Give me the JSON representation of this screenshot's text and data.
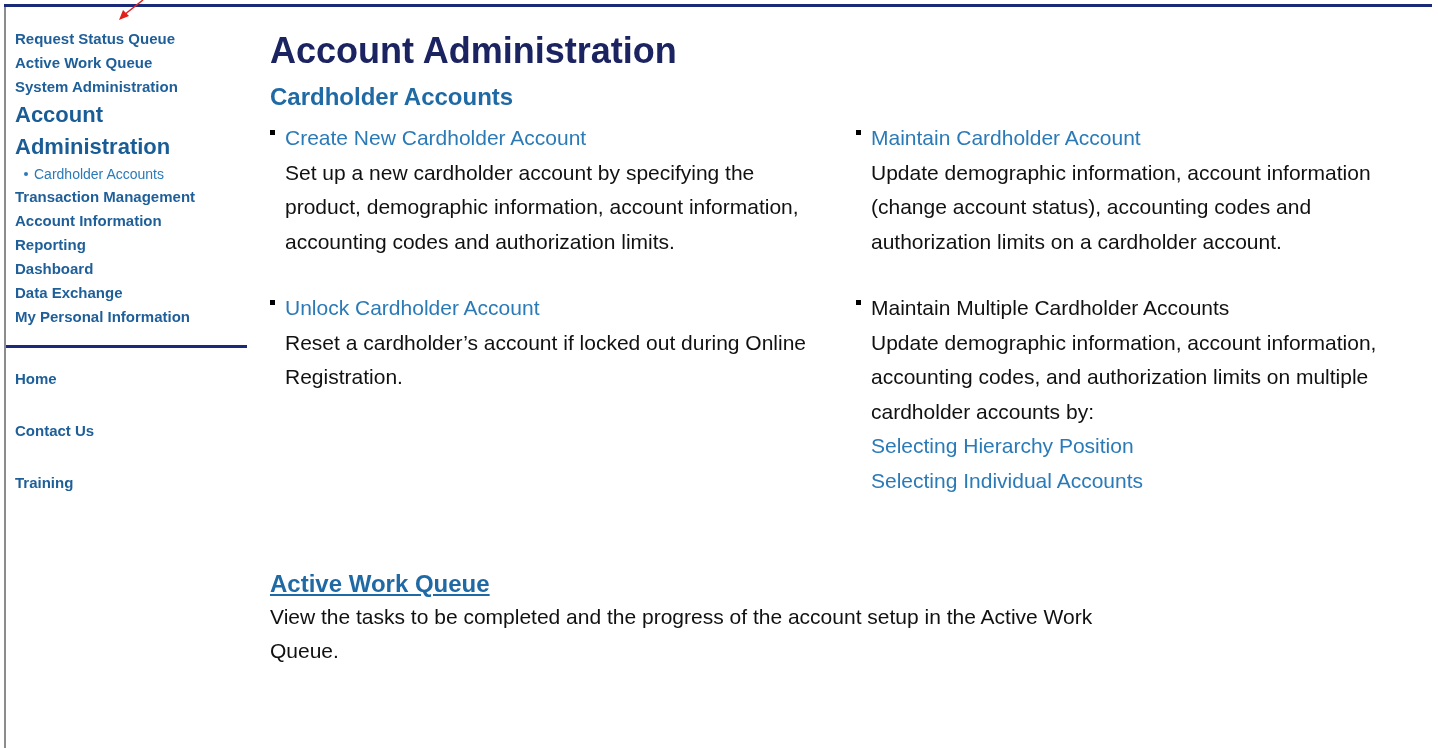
{
  "sidebar": {
    "nav": [
      {
        "label": "Request Status Queue",
        "kind": "link",
        "selected": false
      },
      {
        "label": "Active Work Queue",
        "kind": "link",
        "selected": false
      },
      {
        "label": "System Administration",
        "kind": "link",
        "selected": false
      },
      {
        "label": "Account Administration",
        "kind": "link",
        "selected": true,
        "children": [
          {
            "label": "Cardholder Accounts",
            "kind": "sub",
            "selected": false
          }
        ]
      },
      {
        "label": "Transaction Management",
        "kind": "link",
        "selected": false
      },
      {
        "label": "Account Information",
        "kind": "link",
        "selected": false
      },
      {
        "label": "Reporting",
        "kind": "link",
        "selected": false
      },
      {
        "label": "Dashboard",
        "kind": "link",
        "selected": false
      },
      {
        "label": "Data Exchange",
        "kind": "link",
        "selected": false
      },
      {
        "label": "My Personal Information",
        "kind": "link",
        "selected": false
      }
    ],
    "footer_links": [
      "Home",
      "Contact Us",
      "Training"
    ]
  },
  "page_title": "Account Administration",
  "section_title": "Cardholder Accounts",
  "items": [
    {
      "title": "Create New Cardholder Account",
      "kind": "link",
      "description": "Set up a new cardholder account by specifying the product, demographic information, account information, accounting codes and authorization limits."
    },
    {
      "title": "Maintain Cardholder Account",
      "kind": "link",
      "description": "Update demographic information, account information (change account status), accounting codes and authorization limits on a cardholder account."
    },
    {
      "title": "Unlock Cardholder Account",
      "kind": "link",
      "description": "Reset a cardholder’s account if locked out during Online Registration."
    },
    {
      "title": "Maintain Multiple Cardholder Accounts",
      "kind": "plain",
      "description": "Update demographic information, account information, accounting codes, and authorization limits on multiple cardholder accounts by:",
      "links": [
        "Selecting Hierarchy Position",
        "Selecting Individual Accounts"
      ]
    }
  ],
  "active_work_queue": {
    "title": "Active Work Queue",
    "description": "View the tasks to be completed and the progress of the account setup in the Active Work Queue."
  }
}
